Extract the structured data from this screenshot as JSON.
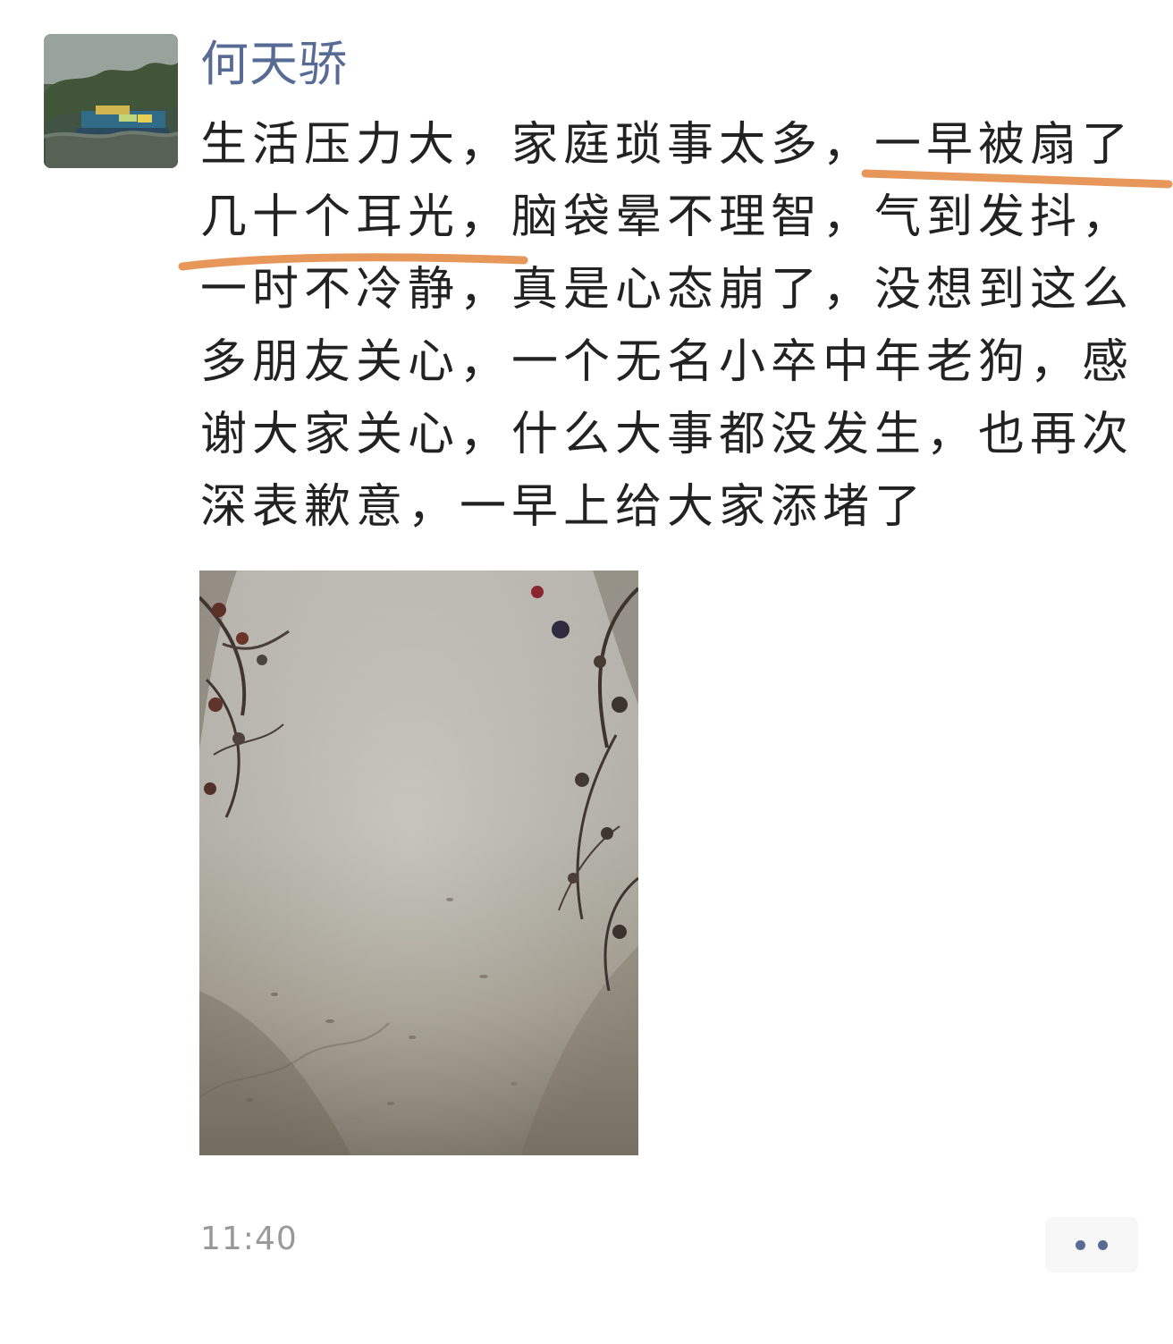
{
  "post": {
    "author": "何天骄",
    "text": "生活压力大，家庭琐事太多，一早被扇了几十个耳光，脑袋晕不理智，气到发抖，一时不冷静，真是心态崩了，没想到这么多朋友关心，一个无名小卒中年老狗，感谢大家关心，什么大事都没发生，也再次深表歉意，一早上给大家添堵了",
    "time": "11:40",
    "highlight_color": "#e8975a",
    "name_color": "#576b95"
  },
  "icons": {
    "more": "more-dots-icon"
  }
}
